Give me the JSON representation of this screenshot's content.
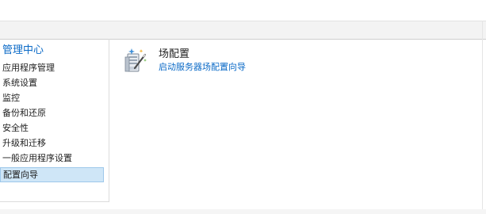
{
  "quick_launch": {
    "heading": "管理中心",
    "items": [
      {
        "label": "应用程序管理"
      },
      {
        "label": "系统设置"
      },
      {
        "label": "监控"
      },
      {
        "label": "备份和还原"
      },
      {
        "label": "安全性"
      },
      {
        "label": "升级和迁移"
      },
      {
        "label": "一般应用程序设置"
      },
      {
        "label": "配置向导",
        "selected": true
      }
    ]
  },
  "main": {
    "section_title": "场配置",
    "link_label": "启动服务器场配置向导",
    "icon": "farm-config-wizard-icon"
  },
  "colors": {
    "link": "#0b6ac7",
    "selected_bg": "#cfe6f7",
    "selected_border": "#9ec8ea"
  }
}
